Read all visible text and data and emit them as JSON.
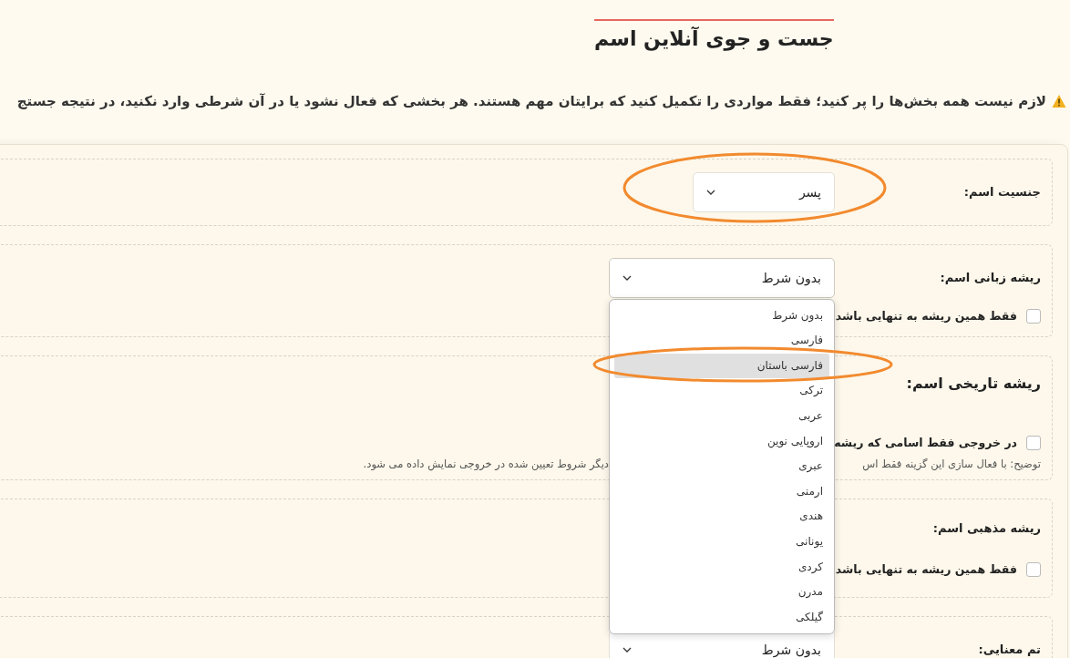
{
  "page": {
    "title": "جست و جوی آنلاین اسم",
    "notice": "لازم نیست همه بخش‌ها را پر کنید؛ فقط مواردی را تکمیل کنید که برایتان مهم هستند. هر بخشی که فعال نشود یا در آن شرطی وارد نکنید، در نتیجه جستج"
  },
  "sections": [
    {
      "kind": "select",
      "label": "جنسیت اسم:",
      "select": {
        "value": "پسر",
        "expanded": false
      }
    },
    {
      "kind": "select",
      "label": "ریشه زبانی اسم:",
      "select": {
        "value": "بدون شرط",
        "expanded": true,
        "options": [
          {
            "label": "بدون شرط",
            "highlighted": false
          },
          {
            "label": "فارسی",
            "highlighted": false
          },
          {
            "label": "فارسی باستان",
            "highlighted": true
          },
          {
            "label": "ترکی",
            "highlighted": false
          },
          {
            "label": "عربی",
            "highlighted": false
          },
          {
            "label": "اروپایی نوین",
            "highlighted": false
          },
          {
            "label": "عبری",
            "highlighted": false
          },
          {
            "label": "ارمنی",
            "highlighted": false
          },
          {
            "label": "هندی",
            "highlighted": false
          },
          {
            "label": "یونانی",
            "highlighted": false
          },
          {
            "label": "کردی",
            "highlighted": false
          },
          {
            "label": "مدرن",
            "highlighted": false
          },
          {
            "label": "گیلکی",
            "highlighted": false
          }
        ]
      },
      "checkbox": {
        "label": "فقط همین ریشه به تنهایی باشد",
        "checked": false
      }
    },
    {
      "kind": "heading",
      "label": "ریشه تاریخی اسم:",
      "checkbox": {
        "label": "در خروجی فقط اسامی که ریشه",
        "checked": false
      },
      "description": [
        "توضیح: با فعال سازی این گزینه فقط اس",
        "دیگر شروط تعیین شده در خروجی نمایش داده می شود."
      ]
    },
    {
      "kind": "label",
      "label": "ریشه مذهبی اسم:",
      "checkbox": {
        "label": "فقط همین ریشه به تنهایی باشد",
        "checked": false
      }
    },
    {
      "kind": "select",
      "label": "تم معنایی:",
      "select": {
        "value": "بدون شرط",
        "expanded": false
      }
    }
  ]
}
